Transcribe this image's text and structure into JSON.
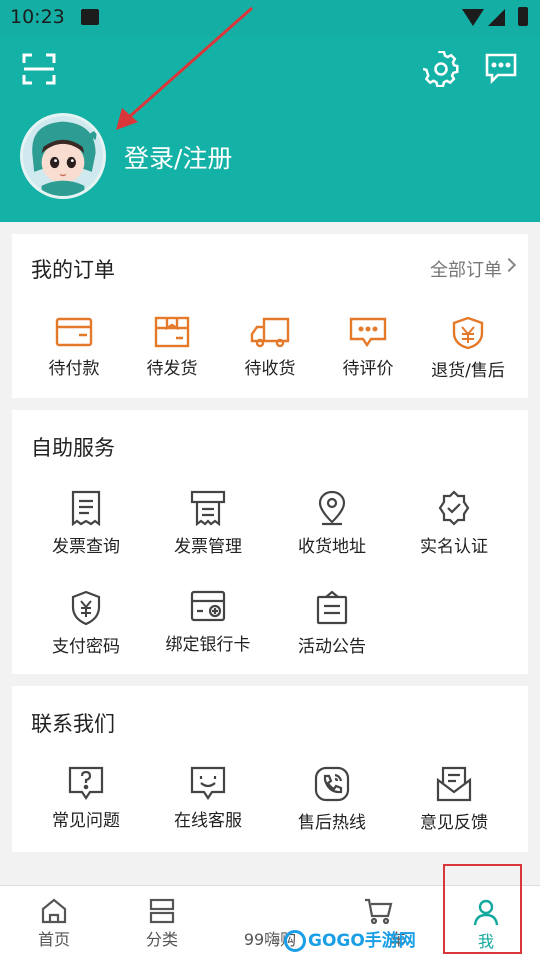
{
  "status_bar": {
    "time": "10:23"
  },
  "header": {
    "scan_icon": "scan-icon",
    "settings_icon": "gear-icon",
    "message_icon": "message-icon",
    "login_text": "登录/注册"
  },
  "orders": {
    "title": "我的订单",
    "all_orders": "全部订单",
    "items": [
      {
        "label": "待付款",
        "icon": "wallet-icon"
      },
      {
        "label": "待发货",
        "icon": "package-icon"
      },
      {
        "label": "待收货",
        "icon": "truck-icon"
      },
      {
        "label": "待评价",
        "icon": "comment-icon"
      },
      {
        "label": "退货/售后",
        "icon": "return-shield-icon"
      }
    ],
    "accent": "#e5792a"
  },
  "self_service": {
    "title": "自助服务",
    "items": [
      {
        "label": "发票查询",
        "icon": "invoice-icon"
      },
      {
        "label": "发票管理",
        "icon": "invoice-manage-icon"
      },
      {
        "label": "收货地址",
        "icon": "location-icon"
      },
      {
        "label": "实名认证",
        "icon": "verified-badge-icon"
      },
      {
        "label": "支付密码",
        "icon": "pay-shield-icon"
      },
      {
        "label": "绑定银行卡",
        "icon": "bank-card-icon"
      },
      {
        "label": "活动公告",
        "icon": "announcement-icon"
      }
    ]
  },
  "contact": {
    "title": "联系我们",
    "items": [
      {
        "label": "常见问题",
        "icon": "question-icon"
      },
      {
        "label": "在线客服",
        "icon": "chat-face-icon"
      },
      {
        "label": "售后热线",
        "icon": "phone-icon"
      },
      {
        "label": "意见反馈",
        "icon": "mail-feedback-icon"
      }
    ]
  },
  "bottom_nav": {
    "items": [
      {
        "label": "首页",
        "icon": "home-icon"
      },
      {
        "label": "分类",
        "icon": "category-icon"
      },
      {
        "label": "99嗨购",
        "icon": ""
      },
      {
        "label": "车",
        "icon": "cart-icon"
      },
      {
        "label": "我",
        "icon": "user-icon"
      }
    ],
    "active_color": "#13a89e"
  },
  "watermark": {
    "text": "GOGO手游网"
  },
  "colors": {
    "header_bg": "#14b1a6",
    "highlight": "#d9373a"
  }
}
